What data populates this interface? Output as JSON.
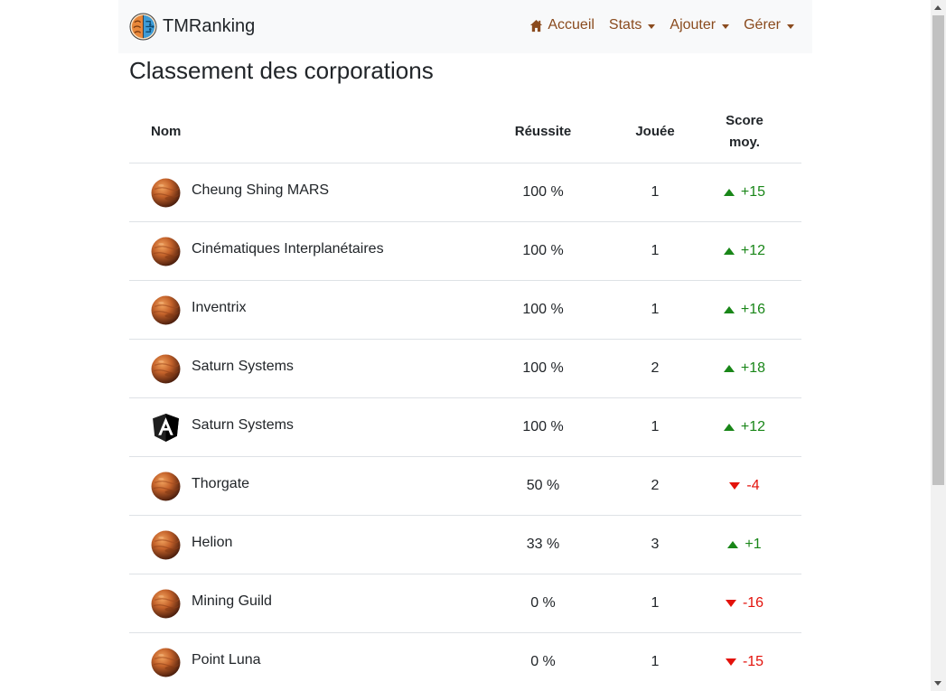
{
  "navbar": {
    "brand": "TMRanking",
    "brand_icon": "brain-icon",
    "items": [
      {
        "label": "Accueil",
        "icon": "home-icon"
      },
      {
        "label": "Stats",
        "dropdown": true
      },
      {
        "label": "Ajouter",
        "dropdown": true
      },
      {
        "label": "Gérer",
        "dropdown": true
      }
    ]
  },
  "page": {
    "title": "Classement des corporations"
  },
  "table": {
    "headers": {
      "name": "Nom",
      "rate": "Réussite",
      "played": "Jouée",
      "score_line1": "Score",
      "score_line2": "moy."
    },
    "rows": [
      {
        "avatar": "mars-planet-icon",
        "name": "Cheung Shing MARS",
        "rate": "100 %",
        "played": "1",
        "score": "+15",
        "trend": "up"
      },
      {
        "avatar": "mars-planet-icon",
        "name": "Cinématiques Interplanétaires",
        "rate": "100 %",
        "played": "1",
        "score": "+12",
        "trend": "up"
      },
      {
        "avatar": "mars-planet-icon",
        "name": "Inventrix",
        "rate": "100 %",
        "played": "1",
        "score": "+16",
        "trend": "up"
      },
      {
        "avatar": "mars-planet-icon",
        "name": "Saturn Systems",
        "rate": "100 %",
        "played": "2",
        "score": "+18",
        "trend": "up"
      },
      {
        "avatar": "angular-logo-icon",
        "name": "Saturn Systems",
        "rate": "100 %",
        "played": "1",
        "score": "+12",
        "trend": "up"
      },
      {
        "avatar": "mars-planet-icon",
        "name": "Thorgate",
        "rate": "50 %",
        "played": "2",
        "score": "-4",
        "trend": "down"
      },
      {
        "avatar": "mars-planet-icon",
        "name": "Helion",
        "rate": "33 %",
        "played": "3",
        "score": "+1",
        "trend": "up"
      },
      {
        "avatar": "mars-planet-icon",
        "name": "Mining Guild",
        "rate": "0 %",
        "played": "1",
        "score": "-16",
        "trend": "down"
      },
      {
        "avatar": "mars-planet-icon",
        "name": "Point Luna",
        "rate": "0 %",
        "played": "1",
        "score": "-15",
        "trend": "down"
      }
    ]
  },
  "colors": {
    "up": "#198618",
    "down": "#e3120b",
    "nav_link": "#8a4b1e",
    "navbar_bg": "#f8f9fa"
  }
}
